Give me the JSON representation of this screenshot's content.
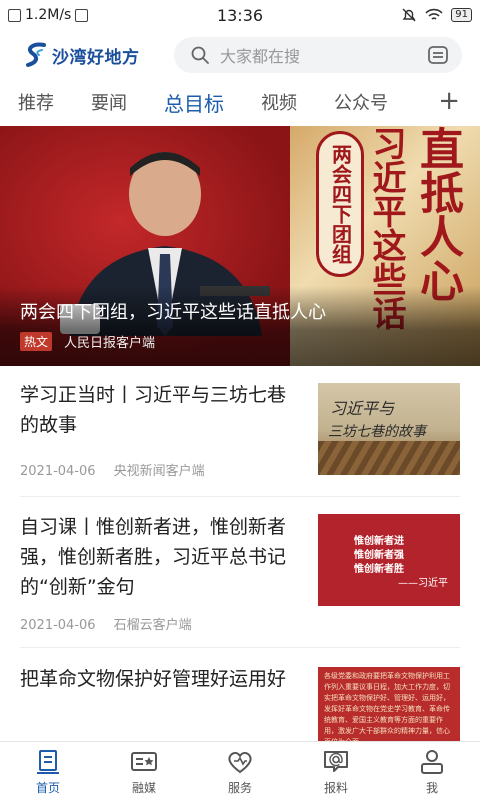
{
  "status_bar": {
    "speed": "1.2M/s",
    "time": "13:36",
    "battery": "91"
  },
  "header": {
    "app_name": "沙湾好地方",
    "search_placeholder": "大家都在搜"
  },
  "tabs": [
    {
      "label": "推荐",
      "active": false
    },
    {
      "label": "要闻",
      "active": false
    },
    {
      "label": "总目标",
      "active": true
    },
    {
      "label": "视频",
      "active": false
    },
    {
      "label": "公众号",
      "active": false
    }
  ],
  "tab_add": "+",
  "hero": {
    "title": "两会四下团组，习近平这些话直抵人心",
    "badge": "热文",
    "source": "人民日报客户端",
    "image_text_box": "两会四下团组",
    "image_text_mid": "习近平这些话",
    "image_text_big": "直抵人心"
  },
  "news": [
    {
      "title": "学习正当时丨习近平与三坊七巷的故事",
      "date": "2021-04-06",
      "source": "央视新闻客户端",
      "thumb_text_1": "习近平与",
      "thumb_text_2": "三坊七巷的故事"
    },
    {
      "title": "自习课丨惟创新者进，惟创新者强，惟创新者胜，习近平总书记的“创新”金句",
      "date": "2021-04-06",
      "source": "石榴云客户端",
      "thumb_lines": [
        "惟创新者进",
        "惟创新者强",
        "惟创新者胜"
      ],
      "thumb_sig": "——习近平"
    },
    {
      "title": "把革命文物保护好管理好运用好",
      "thumb_text": "各级党委和政府要把革命文物保护利用工作列入重要议事日程，加大工作力度，切实把革命文物保护好、管理好、运用好，发挥好革命文物在党史学习教育、革命传统教育、爱国主义教育等方面的重要作用，激发广大干部群众的精神力量，信心百倍为全面"
    }
  ],
  "bottom_nav": [
    {
      "label": "首页",
      "icon": "home-icon",
      "active": true
    },
    {
      "label": "融媒",
      "icon": "media-card-icon",
      "active": false
    },
    {
      "label": "服务",
      "icon": "heart-service-icon",
      "active": false
    },
    {
      "label": "报料",
      "icon": "report-chat-icon",
      "active": false
    },
    {
      "label": "我",
      "icon": "user-icon",
      "active": false
    }
  ],
  "colors": {
    "accent": "#1c5cab",
    "hot_badge": "#c0392b"
  }
}
